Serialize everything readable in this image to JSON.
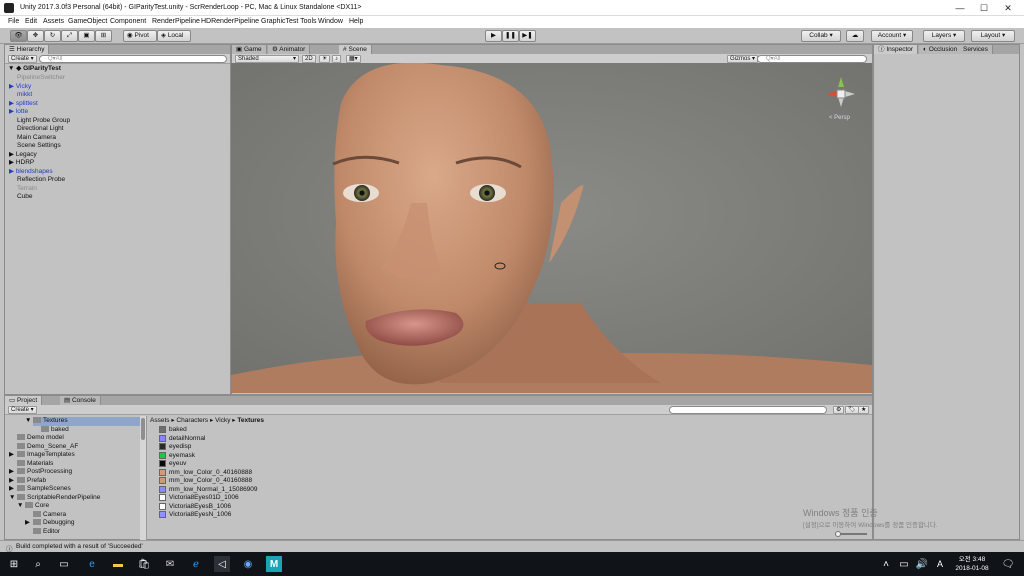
{
  "window": {
    "title": "Unity 2017.3.0f3 Personal (64bit) - GIParityTest.unity - ScrRenderLoop - PC, Mac & Linux Standalone <DX11>"
  },
  "menu": [
    "File",
    "Edit",
    "Assets",
    "GameObject",
    "Component",
    "RenderPipeline",
    "HDRenderPipeline",
    "GraphicTest Tools",
    "Window",
    "Help"
  ],
  "toolbar": {
    "pivot": "Pivot",
    "local": "Local",
    "collab": "Collab ▾",
    "account": "Account",
    "layers": "Layers",
    "layout": "Layout"
  },
  "hierarchy": {
    "tab": "Hierarchy",
    "create": "Create ▾",
    "search_placeholder": "Q▾All",
    "scene": "GIParityTest",
    "items": [
      {
        "label": "PipelineSwitcher",
        "style": "grey",
        "indent": 1,
        "arrow": ""
      },
      {
        "label": "Vicky",
        "style": "blue",
        "indent": 1,
        "arrow": "▶"
      },
      {
        "label": "mikkt",
        "style": "blue",
        "indent": 1,
        "arrow": ""
      },
      {
        "label": "splittest",
        "style": "blue",
        "indent": 1,
        "arrow": "▶"
      },
      {
        "label": "lotte",
        "style": "blue",
        "indent": 1,
        "arrow": "▶"
      },
      {
        "label": "Light Probe Group",
        "style": "",
        "indent": 1,
        "arrow": ""
      },
      {
        "label": "Directional Light",
        "style": "",
        "indent": 1,
        "arrow": ""
      },
      {
        "label": "Main Camera",
        "style": "",
        "indent": 1,
        "arrow": ""
      },
      {
        "label": "Scene Settings",
        "style": "",
        "indent": 1,
        "arrow": ""
      },
      {
        "label": "Legacy",
        "style": "",
        "indent": 1,
        "arrow": "▶"
      },
      {
        "label": "HDRP",
        "style": "",
        "indent": 1,
        "arrow": "▶"
      },
      {
        "label": "blendshapes",
        "style": "blue",
        "indent": 1,
        "arrow": "▶"
      },
      {
        "label": "Reflection Probe",
        "style": "",
        "indent": 1,
        "arrow": ""
      },
      {
        "label": "Terrain",
        "style": "grey",
        "indent": 1,
        "arrow": ""
      },
      {
        "label": "Cube",
        "style": "",
        "indent": 1,
        "arrow": ""
      }
    ]
  },
  "scene_tabs": {
    "game": "Game",
    "animator": "Animator",
    "scene": "Scene",
    "shading": "Shaded",
    "mode2d": "2D",
    "gizmos": "Gizmos ▾",
    "search_placeholder": "Q▾All",
    "persp": "< Persp"
  },
  "inspector": {
    "tab_inspector": "Inspector",
    "tab_occlusion": "Occlusion",
    "tab_services": "Services"
  },
  "project": {
    "tab_project": "Project",
    "tab_console": "Console",
    "create": "Create ▾",
    "breadcrumb": [
      "Assets",
      "Characters",
      "Vicky",
      "Textures"
    ],
    "tree": [
      {
        "label": "Textures",
        "indent": 3,
        "arrow": "▼",
        "selected": true
      },
      {
        "label": "baked",
        "indent": 4,
        "arrow": "",
        "selected": false
      },
      {
        "label": "Demo model",
        "indent": 1,
        "arrow": "",
        "selected": false
      },
      {
        "label": "Demo_Scene_AF",
        "indent": 1,
        "arrow": "",
        "selected": false
      },
      {
        "label": "ImageTemplates",
        "indent": 1,
        "arrow": "▶",
        "selected": false
      },
      {
        "label": "Materials",
        "indent": 1,
        "arrow": "",
        "selected": false
      },
      {
        "label": "PostProcessing",
        "indent": 1,
        "arrow": "▶",
        "selected": false
      },
      {
        "label": "Prefab",
        "indent": 1,
        "arrow": "▶",
        "selected": false
      },
      {
        "label": "SampleScenes",
        "indent": 1,
        "arrow": "▶",
        "selected": false
      },
      {
        "label": "ScriptableRenderPipeline",
        "indent": 1,
        "arrow": "▼",
        "selected": false
      },
      {
        "label": "Core",
        "indent": 2,
        "arrow": "▼",
        "selected": false
      },
      {
        "label": "Camera",
        "indent": 3,
        "arrow": "",
        "selected": false
      },
      {
        "label": "Debugging",
        "indent": 3,
        "arrow": "▶",
        "selected": false
      },
      {
        "label": "Editor",
        "indent": 3,
        "arrow": "",
        "selected": false
      }
    ],
    "files": [
      {
        "label": "baked",
        "color": "#6e6e6e",
        "type": "folder"
      },
      {
        "label": "detailNormal",
        "color": "#8585ff",
        "type": "tex"
      },
      {
        "label": "eyedisp",
        "color": "#2a2a2a",
        "type": "tex"
      },
      {
        "label": "eyemask",
        "color": "#16c946",
        "type": "tex"
      },
      {
        "label": "eyeuv",
        "color": "#0a0a0a",
        "type": "tex"
      },
      {
        "label": "mm_low_Color_0_40160888",
        "color": "#d39a78",
        "type": "tex"
      },
      {
        "label": "mm_low_Color_0_40160888",
        "color": "#cf9878",
        "type": "tex"
      },
      {
        "label": "mm_low_Normal_1_15086909",
        "color": "#8a8aff",
        "type": "tex"
      },
      {
        "label": "Victoria8Eyes01D_1006",
        "color": "#ffffff",
        "type": "tex"
      },
      {
        "label": "Victoria8EyesB_1006",
        "color": "#ffffff",
        "type": "tex"
      },
      {
        "label": "Victoria8EyesN_1006",
        "color": "#9090ff",
        "type": "tex"
      }
    ]
  },
  "watermark": {
    "line1": "Windows 정품 인증",
    "line2": "[설정]으로 이동하여 Windows를 정품 인증합니다."
  },
  "status": {
    "message": "Build completed with a result of 'Succeeded'"
  },
  "taskbar": {
    "time": "오전 3:48",
    "date": "2018-01-08"
  }
}
